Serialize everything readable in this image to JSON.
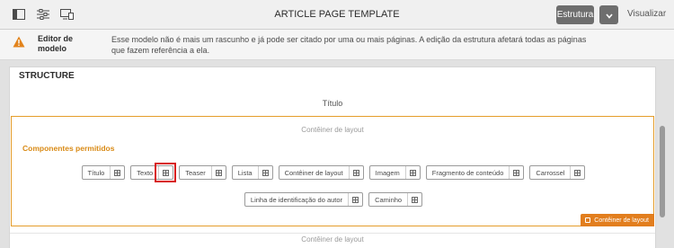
{
  "toolbar": {
    "title": "ARTICLE PAGE TEMPLATE",
    "structure_button": "Estrutura",
    "view_button": "Visualizar",
    "icons": [
      "panel-toggle-icon",
      "properties-icon",
      "emulator-icon",
      "chevron-down-icon"
    ]
  },
  "notice": {
    "title": "Editor de modelo",
    "text": "Esse modelo não é mais um rascunho e já pode ser citado por uma ou mais páginas. A edição da estrutura afetará todas as páginas que fazem referência a ela."
  },
  "editor": {
    "heading": "STRUCTURE",
    "title_component": "Título",
    "layout_container_label": "Contêiner de layout",
    "allowed_components_label": "Componentes permitidos",
    "allowed_components_row1": [
      "Título",
      "Texto",
      "Teaser",
      "Lista",
      "Contêiner de layout",
      "Imagem",
      "Fragmento de conteúdo",
      "Carrossel"
    ],
    "allowed_components_row2": [
      "Linha de identificação do autor",
      "Caminho"
    ],
    "badge_label": "Contêiner de layout",
    "bottom_layout_label": "Contêiner de layout"
  },
  "colors": {
    "accent": "#e59d2b",
    "allowed_label": "#d98a15",
    "badge": "#e27e1e",
    "highlight": "#d81e1e",
    "button": "#6e6e6e"
  }
}
